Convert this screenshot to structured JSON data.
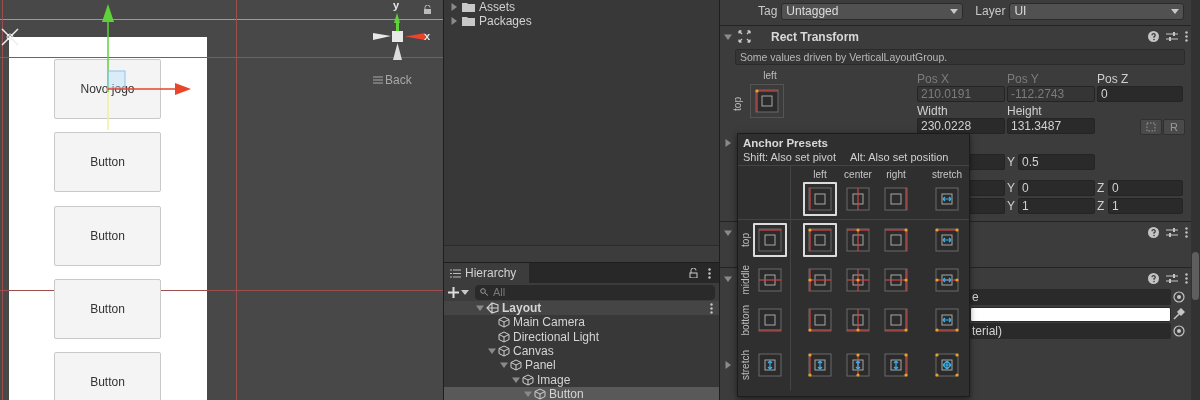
{
  "scene_view": {
    "axis_labels": [
      "y",
      "x"
    ],
    "view_mode": "Back",
    "buttons": [
      "Novo jogo",
      "Button",
      "Button",
      "Button",
      "Button"
    ]
  },
  "project": {
    "folders": [
      {
        "name": "Assets",
        "expanded": false
      },
      {
        "name": "Packages",
        "expanded": false
      }
    ]
  },
  "hierarchy": {
    "title": "Hierarchy",
    "search": {
      "placeholder": "All"
    },
    "tree": [
      {
        "name": "Layout",
        "kind": "scene",
        "selected": false,
        "expanded": true,
        "children": [
          {
            "name": "Main Camera",
            "kind": "object",
            "selected": false
          },
          {
            "name": "Directional Light",
            "kind": "object",
            "selected": false
          },
          {
            "name": "Canvas",
            "kind": "object",
            "selected": false,
            "expanded": true,
            "children": [
              {
                "name": "Panel",
                "kind": "object",
                "selected": false,
                "expanded": true,
                "children": [
                  {
                    "name": "Image",
                    "kind": "object",
                    "selected": false,
                    "expanded": true,
                    "children": [
                      {
                        "name": "Button",
                        "kind": "object",
                        "selected": true,
                        "expanded": true
                      }
                    ]
                  }
                ]
              }
            ]
          }
        ]
      }
    ]
  },
  "inspector": {
    "tag": {
      "label": "Tag",
      "value": "Untagged"
    },
    "layer": {
      "label": "Layer",
      "value": "UI"
    },
    "rect_transform": {
      "title": "Rect Transform",
      "expanded": true,
      "note": "Some values driven by VerticalLayoutGroup.",
      "anchor": {
        "h_label": "left",
        "v_label": "top"
      },
      "fields": [
        {
          "label": "Pos X",
          "value": "210.0191",
          "disabled": true
        },
        {
          "label": "Pos Y",
          "value": "-112.2743",
          "disabled": true
        },
        {
          "label": "Pos Z",
          "value": "0",
          "disabled": false
        },
        {
          "label": "Width",
          "value": "230.0228",
          "disabled": false
        },
        {
          "label": "Height",
          "value": "131.3487",
          "disabled": false
        }
      ],
      "reset_button": "R",
      "anchors_expanded": false,
      "pivot": [
        {
          "label": "Y",
          "value": "0.5"
        }
      ],
      "rotation": [
        {
          "label": "Y",
          "value": "0"
        },
        {
          "label": "Z",
          "value": "0"
        }
      ],
      "scale": [
        {
          "label": "Y",
          "value": "1"
        },
        {
          "label": "Z",
          "value": "1"
        }
      ]
    },
    "components": [
      {
        "expanded": true
      },
      {
        "expanded": true,
        "fields": [
          {
            "kind": "object",
            "value": "e"
          },
          {
            "kind": "color",
            "color": "#ffffff"
          },
          {
            "kind": "object",
            "value": "terial)"
          }
        ]
      }
    ],
    "more_expanded": false,
    "anchor_presets": {
      "title": "Anchor Presets",
      "hints": [
        "Shift: Also set pivot",
        "Alt: Also set position"
      ],
      "columns": [
        {
          "label": "left",
          "selected": true
        },
        {
          "label": "center",
          "selected": false
        },
        {
          "label": "right",
          "selected": false
        },
        {
          "label": "stretch",
          "selected": false
        }
      ],
      "rows": [
        {
          "label": "top",
          "selected": true,
          "cells": [
            {
              "selected": true
            },
            {
              "selected": false
            },
            {
              "selected": false
            },
            {
              "selected": false
            }
          ]
        },
        {
          "label": "middle",
          "selected": false,
          "cells": [
            {
              "selected": false
            },
            {
              "selected": false
            },
            {
              "selected": false
            },
            {
              "selected": false
            }
          ]
        },
        {
          "label": "bottom",
          "selected": false,
          "cells": [
            {
              "selected": false
            },
            {
              "selected": false
            },
            {
              "selected": false
            },
            {
              "selected": false
            }
          ]
        },
        {
          "label": "stretch",
          "selected": false,
          "cells": [
            {
              "selected": false
            },
            {
              "selected": false
            },
            {
              "selected": false
            },
            {
              "selected": false
            }
          ]
        }
      ]
    }
  }
}
